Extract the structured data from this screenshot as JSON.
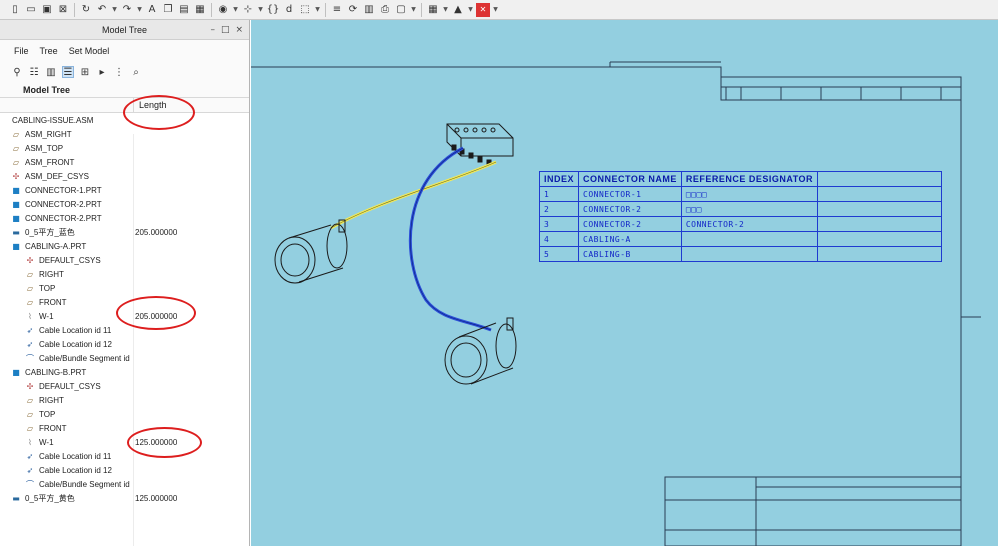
{
  "toolbar": {
    "icons": [
      "new-icon",
      "open-icon",
      "save-icon",
      "close-window-icon",
      "regenerate-icon",
      "undo-icon",
      "redo-icon",
      "text-icon",
      "copy-icon",
      "paste-icon",
      "paste-special-icon",
      "view-icon",
      "datum-icon",
      "braces-icon",
      "dimension-icon",
      "select-icon",
      "layer-icon",
      "repaint-icon",
      "save-copy-icon",
      "print-icon",
      "window-icon",
      "grid-icon",
      "format-icon",
      "close-icon"
    ]
  },
  "panel": {
    "title": "Model Tree",
    "controls": [
      "–",
      "□",
      "×"
    ],
    "menu": [
      "File",
      "Tree",
      "Set Model"
    ],
    "tree_label": "Model Tree",
    "column_header": "Length"
  },
  "tree": [
    {
      "label": "CABLING-ISSUE.ASM",
      "value": "",
      "icon": "assembly-icon",
      "indent": 0
    },
    {
      "label": "ASM_RIGHT",
      "value": "",
      "icon": "datum-plane-icon",
      "indent": 1
    },
    {
      "label": "ASM_TOP",
      "value": "",
      "icon": "datum-plane-icon",
      "indent": 1
    },
    {
      "label": "ASM_FRONT",
      "value": "",
      "icon": "datum-plane-icon",
      "indent": 1
    },
    {
      "label": "ASM_DEF_CSYS",
      "value": "",
      "icon": "csys-icon",
      "indent": 1
    },
    {
      "label": "CONNECTOR-1.PRT",
      "value": "",
      "icon": "part-icon",
      "indent": 1
    },
    {
      "label": "CONNECTOR-2.PRT",
      "value": "",
      "icon": "part-icon",
      "indent": 1
    },
    {
      "label": "CONNECTOR-2.PRT",
      "value": "",
      "icon": "part-icon",
      "indent": 1
    },
    {
      "label": "0_5平方_蓝色",
      "value": "205.000000",
      "icon": "spool-icon",
      "indent": 1
    },
    {
      "label": "CABLING-A.PRT",
      "value": "",
      "icon": "part-icon",
      "indent": 1
    },
    {
      "label": "DEFAULT_CSYS",
      "value": "",
      "icon": "csys-icon",
      "indent": 2
    },
    {
      "label": "RIGHT",
      "value": "",
      "icon": "datum-plane-icon",
      "indent": 2
    },
    {
      "label": "TOP",
      "value": "",
      "icon": "datum-plane-icon",
      "indent": 2
    },
    {
      "label": "FRONT",
      "value": "",
      "icon": "datum-plane-icon",
      "indent": 2
    },
    {
      "label": "W-1",
      "value": "205.000000",
      "icon": "wire-icon",
      "indent": 2
    },
    {
      "label": "Cable Location id 11",
      "value": "",
      "icon": "cable-location-icon",
      "indent": 2
    },
    {
      "label": "Cable Location id 12",
      "value": "",
      "icon": "cable-location-icon",
      "indent": 2
    },
    {
      "label": "Cable/Bundle Segment id",
      "value": "",
      "icon": "cable-segment-icon",
      "indent": 2
    },
    {
      "label": "CABLING-B.PRT",
      "value": "",
      "icon": "part-icon",
      "indent": 1
    },
    {
      "label": "DEFAULT_CSYS",
      "value": "",
      "icon": "csys-icon",
      "indent": 2
    },
    {
      "label": "RIGHT",
      "value": "",
      "icon": "datum-plane-icon",
      "indent": 2
    },
    {
      "label": "TOP",
      "value": "",
      "icon": "datum-plane-icon",
      "indent": 2
    },
    {
      "label": "FRONT",
      "value": "",
      "icon": "datum-plane-icon",
      "indent": 2
    },
    {
      "label": "W-1",
      "value": "125.000000",
      "icon": "wire-icon",
      "indent": 2
    },
    {
      "label": "Cable Location id 11",
      "value": "",
      "icon": "cable-location-icon",
      "indent": 2
    },
    {
      "label": "Cable Location id 12",
      "value": "",
      "icon": "cable-location-icon",
      "indent": 2
    },
    {
      "label": "Cable/Bundle Segment id",
      "value": "",
      "icon": "cable-segment-icon",
      "indent": 2
    },
    {
      "label": "0_5平方_黄色",
      "value": "125.000000",
      "icon": "spool-icon",
      "indent": 1
    }
  ],
  "table": {
    "headers": [
      "INDEX",
      "CONNECTOR NAME",
      "REFERENCE DESIGNATOR",
      ""
    ],
    "rows": [
      [
        "1",
        "CONNECTOR-1",
        "□□□□",
        ""
      ],
      [
        "2",
        "CONNECTOR-2",
        "□□□",
        ""
      ],
      [
        "3",
        "CONNECTOR-2",
        "CONNECTOR-2",
        ""
      ],
      [
        "4",
        "CABLING-A",
        "",
        ""
      ],
      [
        "5",
        "CABLING-B",
        "",
        ""
      ]
    ]
  },
  "colors": {
    "sheet_background": "#93cfe0",
    "table_ink": "#1326c8",
    "highlight_ellipse": "#dd1e1e",
    "cable_yellow": "#f2ea55",
    "cable_blue": "#2b4fd8"
  }
}
